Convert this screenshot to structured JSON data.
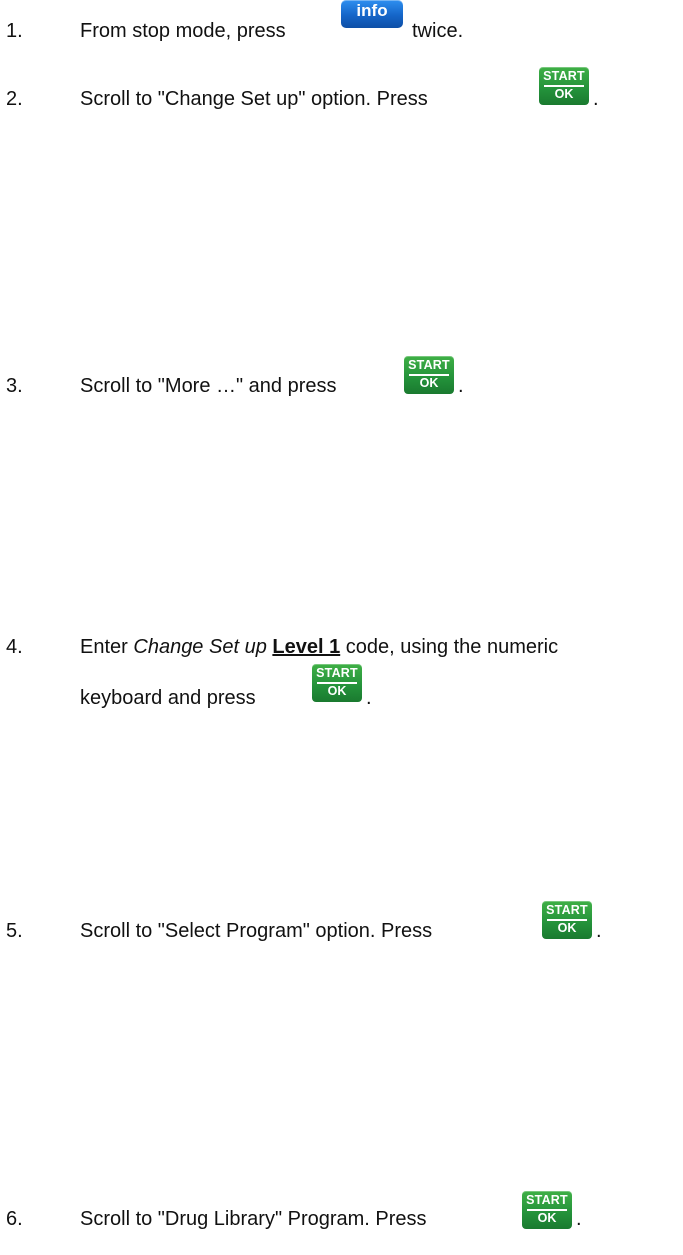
{
  "steps": [
    {
      "number": "1.",
      "before": "From stop mode, press",
      "after": "twice.",
      "key": "info-icon"
    },
    {
      "number": "2.",
      "before": "Scroll to \"Change Set up\" option.  Press",
      "after": ".",
      "key": "start-ok-icon"
    },
    {
      "number": "3.",
      "before": "Scroll to \"More …\" and press",
      "after": ".",
      "key": "start-ok-icon"
    },
    {
      "number": "4.",
      "before": "Enter",
      "italic": "Change Set up",
      "bold": "Level 1",
      "middle": "code, using the numeric",
      "line2_before": "keyboard and press",
      "after": ".",
      "key": "start-ok-icon"
    },
    {
      "number": "5.",
      "before": "Scroll to \"Select Program\" option.  Press",
      "after": ".",
      "key": "start-ok-icon"
    },
    {
      "number": "6.",
      "before": "Scroll to \"Drug Library\" Program. Press",
      "after": ".",
      "key": "start-ok-icon"
    }
  ],
  "keys": {
    "info_label": "info",
    "start_label": "START",
    "ok_label": "OK"
  },
  "colors": {
    "info_key": "#1565c8",
    "start_ok_key": "#23913a"
  }
}
